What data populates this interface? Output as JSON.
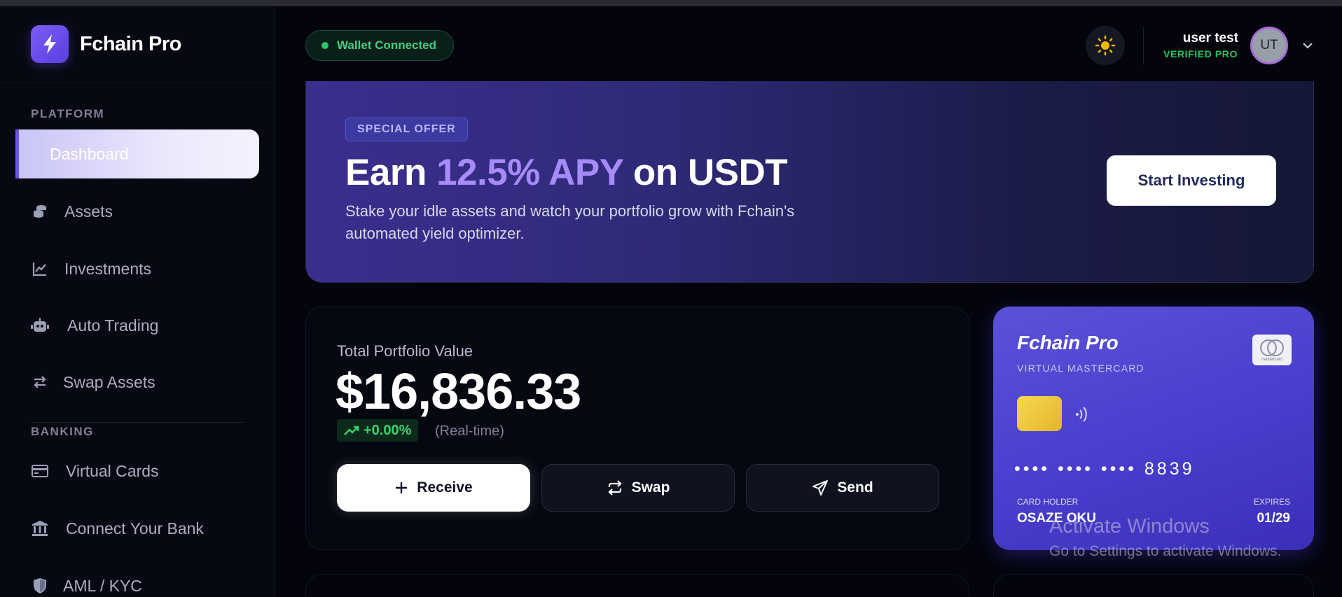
{
  "app": {
    "name": "Fchain Pro"
  },
  "sidebar": {
    "platform_label": "PLATFORM",
    "banking_label": "BANKING",
    "items": [
      {
        "label": "Dashboard",
        "icon": "dashboard-icon",
        "active": true
      },
      {
        "label": "Assets",
        "icon": "coins-icon"
      },
      {
        "label": "Investments",
        "icon": "chart-line-icon"
      },
      {
        "label": "Auto Trading",
        "icon": "robot-icon"
      },
      {
        "label": "Swap Assets",
        "icon": "swap-icon"
      },
      {
        "label": "Virtual Cards",
        "icon": "credit-card-icon"
      },
      {
        "label": "Connect Your Bank",
        "icon": "bank-icon"
      },
      {
        "label": "AML / KYC",
        "icon": "shield-icon"
      }
    ]
  },
  "header": {
    "wallet_status": "Wallet Connected",
    "theme_icon": "sun-icon",
    "user": {
      "name": "user test",
      "badge": "VERIFIED PRO",
      "initials": "UT"
    }
  },
  "promo": {
    "tag": "SPECIAL OFFER",
    "title_pre": "Earn ",
    "title_highlight": "12.5% APY",
    "title_post": " on USDT",
    "description": "Stake your idle assets and watch your portfolio grow with Fchain's automated yield optimizer.",
    "cta": "Start Investing"
  },
  "portfolio": {
    "label": "Total Portfolio Value",
    "value": "$16,836.33",
    "change": "+0.00%",
    "note": "(Real-time)",
    "actions": {
      "receive": "Receive",
      "swap": "Swap",
      "send": "Send"
    }
  },
  "card": {
    "brand": "Fchain Pro",
    "type": "VIRTUAL MASTERCARD",
    "logo_text": "mastercard",
    "number": "•••• •••• •••• 8839",
    "holder_label": "CARD HOLDER",
    "holder": "OSAZE OKU",
    "expires_label": "EXPIRES",
    "expires": "01/29"
  },
  "watermark": {
    "line1": "Activate Windows",
    "line2": "Go to Settings to activate Windows."
  },
  "colors": {
    "accent": "#6c55e6",
    "highlight": "#a78bfa",
    "success": "#22c55e",
    "background": "#03040c"
  }
}
